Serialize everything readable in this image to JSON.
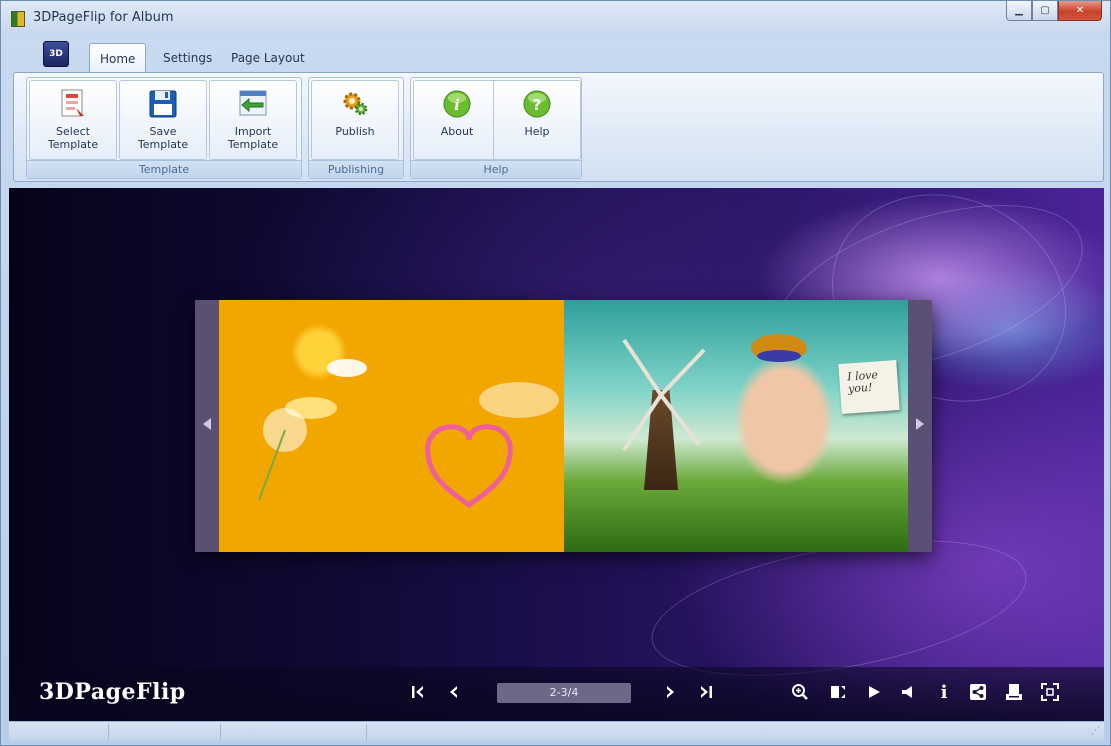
{
  "window": {
    "title": "3DPageFlip for Album",
    "controls": [
      "minimize-icon",
      "maximize-icon",
      "close-icon"
    ]
  },
  "app_button": {
    "label": "3D"
  },
  "tabs": [
    {
      "label": "Home",
      "active": true
    },
    {
      "label": "Settings",
      "active": false
    },
    {
      "label": "Page Layout",
      "active": false
    }
  ],
  "ribbon": {
    "groups": [
      {
        "label": "Template",
        "buttons": [
          {
            "label": "Select\nTemplate",
            "icon": "select-template-icon"
          },
          {
            "label": "Save\nTemplate",
            "icon": "save-floppy-icon"
          },
          {
            "label": "Import\nTemplate",
            "icon": "import-arrow-icon"
          }
        ]
      },
      {
        "label": "Publishing",
        "buttons": [
          {
            "label": "Publish",
            "icon": "publish-gears-icon"
          }
        ]
      },
      {
        "label": "Help",
        "buttons": [
          {
            "label": "About",
            "icon": "about-info-icon"
          },
          {
            "label": "Help",
            "icon": "help-question-icon"
          }
        ]
      }
    ]
  },
  "book": {
    "note_text": "I love you!"
  },
  "toolbar": {
    "brand": "3DPageFlip",
    "page_indicator": "2-3/4",
    "nav_icons": [
      "first-page-icon",
      "prev-page-icon",
      "next-page-icon",
      "last-page-icon"
    ],
    "tool_icons": [
      "zoom-in-icon",
      "thumbnails-icon",
      "autoplay-icon",
      "sound-icon",
      "info-icon",
      "share-icon",
      "print-icon",
      "fullscreen-icon"
    ]
  },
  "colors": {
    "ribbon_bg": "#dbe7f5",
    "stage_dark": "#120b3a",
    "stage_purple": "#4b2499",
    "page_box": "#6d6888"
  }
}
